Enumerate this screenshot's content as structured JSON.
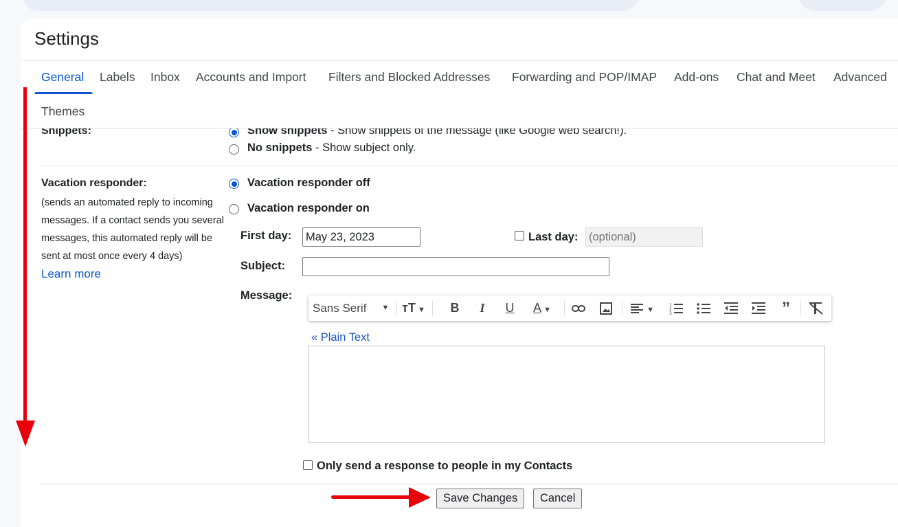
{
  "page": {
    "title": "Settings"
  },
  "tabs": [
    {
      "label": "General",
      "active": true
    },
    {
      "label": "Labels"
    },
    {
      "label": "Inbox"
    },
    {
      "label": "Accounts and Import"
    },
    {
      "label": "Filters and Blocked Addresses"
    },
    {
      "label": "Forwarding and POP/IMAP"
    },
    {
      "label": "Add-ons"
    },
    {
      "label": "Chat and Meet"
    },
    {
      "label": "Advanced"
    },
    {
      "label": "Themes"
    }
  ],
  "snippets": {
    "label": "Snippets:",
    "options": [
      {
        "bold": "Show snippets",
        "desc": " - Show snippets of the message (like Google web search!).",
        "selected": true
      },
      {
        "bold": "No snippets",
        "desc": " - Show subject only.",
        "selected": false
      }
    ]
  },
  "vacation": {
    "label": "Vacation responder:",
    "note": "(sends an automated reply to incoming messages. If a contact sends you several messages, this automated reply will be sent at most once every 4 days)",
    "learn_more": "Learn more",
    "off_label": "Vacation responder off",
    "on_label": "Vacation responder on",
    "off_selected": true,
    "first_day_label": "First day:",
    "first_day_value": "May 23, 2023",
    "last_day_label": "Last day:",
    "last_day_placeholder": "(optional)",
    "last_day_checked": false,
    "subject_label": "Subject:",
    "subject_value": "",
    "message_label": "Message:",
    "plain_text_link": "« Plain Text",
    "contacts_only_label": "Only send a response to people in my Contacts",
    "contacts_only_checked": false
  },
  "toolbar": {
    "font_label": "Sans Serif",
    "icons": [
      "font-size-icon",
      "bold-icon",
      "italic-icon",
      "underline-icon",
      "text-color-icon",
      "link-icon",
      "image-icon",
      "align-icon",
      "numbered-list-icon",
      "bulleted-list-icon",
      "indent-less-icon",
      "indent-more-icon",
      "quote-icon",
      "remove-formatting-icon"
    ]
  },
  "actions": {
    "save_label": "Save Changes",
    "cancel_label": "Cancel"
  },
  "colors": {
    "accent": "#0b57d0",
    "annotation_arrow": "#e8000b"
  }
}
